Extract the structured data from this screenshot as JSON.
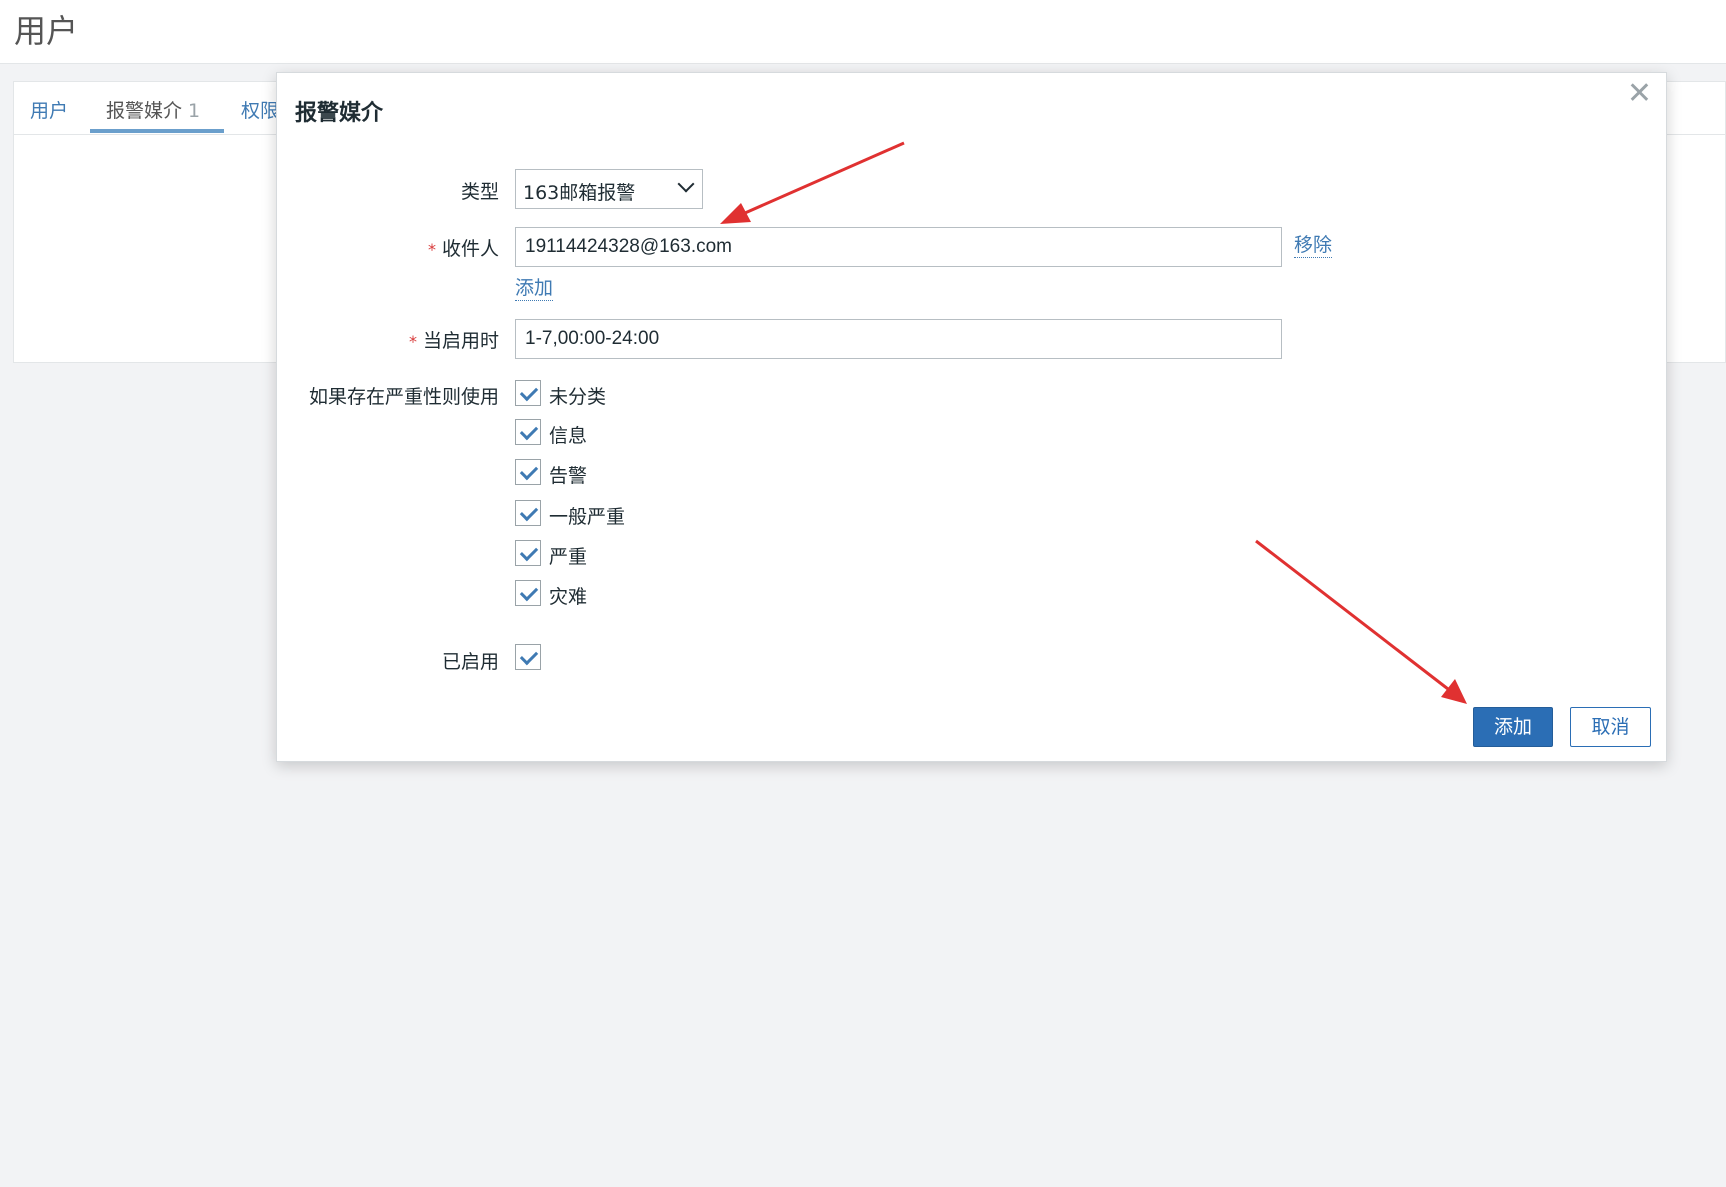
{
  "page": {
    "title": "用户"
  },
  "tabs": [
    {
      "label": "用户",
      "count": ""
    },
    {
      "label": "报警媒介",
      "count": "1"
    },
    {
      "label": "权限",
      "count": ""
    }
  ],
  "dialog": {
    "title": "报警媒介",
    "close_icon": "close-icon",
    "type": {
      "label": "类型",
      "value": "163邮箱报警"
    },
    "recipient": {
      "label": "收件人",
      "value": "19114424328@163.com",
      "remove_label": "移除",
      "add_label": "添加"
    },
    "when_active": {
      "label": "当启用时",
      "value": "1-7,00:00-24:00"
    },
    "severity": {
      "label": "如果存在严重性则使用",
      "options": [
        {
          "label": "未分类",
          "checked": true
        },
        {
          "label": "信息",
          "checked": true
        },
        {
          "label": "告警",
          "checked": true
        },
        {
          "label": "一般严重",
          "checked": true
        },
        {
          "label": "严重",
          "checked": true
        },
        {
          "label": "灾难",
          "checked": true
        }
      ]
    },
    "enabled": {
      "label": "已启用",
      "checked": true
    },
    "buttons": {
      "add": "添加",
      "cancel": "取消"
    }
  },
  "colors": {
    "accent": "#2b6eb5",
    "required": "#d83a3a",
    "annotation_arrow": "#e03131"
  }
}
